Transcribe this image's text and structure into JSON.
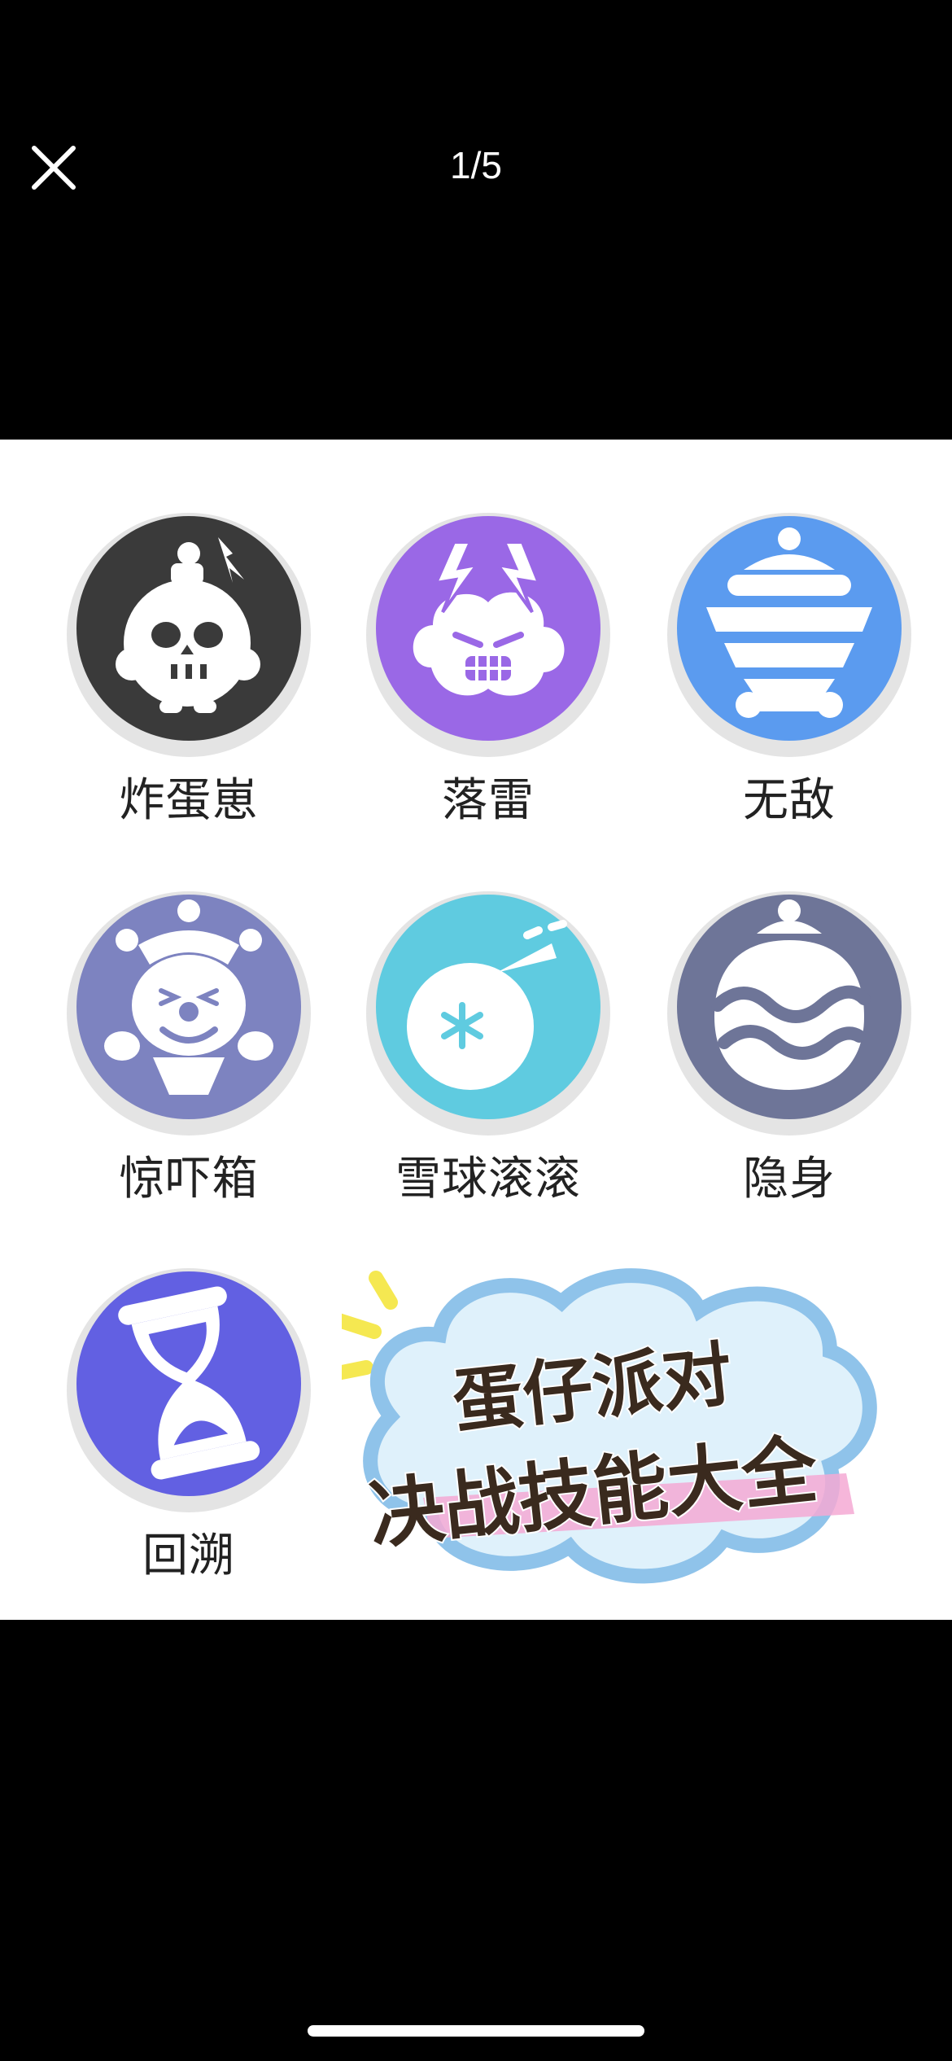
{
  "viewer": {
    "counter": "1/5"
  },
  "skills": [
    {
      "name": "炸蛋崽",
      "icon": "bomb-skull-icon",
      "color": "#3a3a3a"
    },
    {
      "name": "落雷",
      "icon": "thunder-cloud-icon",
      "color": "#9a68e6"
    },
    {
      "name": "无敌",
      "icon": "invincible-pot-icon",
      "color": "#5b9bef"
    },
    {
      "name": "惊吓箱",
      "icon": "jack-in-box-clown-icon",
      "color": "#7d83c0"
    },
    {
      "name": "雪球滚滚",
      "icon": "snowball-icon",
      "color": "#5fcbe0"
    },
    {
      "name": "隐身",
      "icon": "invisible-face-icon",
      "color": "#6e7598"
    },
    {
      "name": "回溯",
      "icon": "hourglass-icon",
      "color": "#6260e2"
    }
  ],
  "banner": {
    "line1": "蛋仔派对",
    "line2": "决战技能大全"
  }
}
